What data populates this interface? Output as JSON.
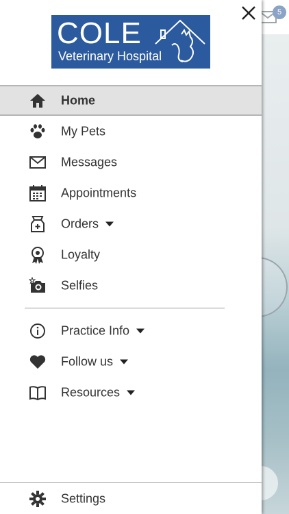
{
  "background": {
    "mail_badge_count": "5"
  },
  "logo": {
    "title": "COLE",
    "subtitle": "Veterinary Hospital"
  },
  "menu": {
    "items": [
      {
        "label": "Home",
        "icon": "home-icon",
        "active": true
      },
      {
        "label": "My Pets",
        "icon": "paw-icon"
      },
      {
        "label": "Messages",
        "icon": "envelope-icon"
      },
      {
        "label": "Appointments",
        "icon": "calendar-icon"
      },
      {
        "label": "Orders",
        "icon": "pet-food-bag-icon",
        "dropdown": true
      },
      {
        "label": "Loyalty",
        "icon": "award-ribbon-icon"
      },
      {
        "label": "Selfies",
        "icon": "camera-icon"
      }
    ],
    "secondary": [
      {
        "label": "Practice Info",
        "icon": "info-icon",
        "dropdown": true
      },
      {
        "label": "Follow us",
        "icon": "heart-icon",
        "dropdown": true
      },
      {
        "label": "Resources",
        "icon": "book-icon",
        "dropdown": true
      }
    ],
    "settings": {
      "label": "Settings",
      "icon": "gear-icon"
    }
  },
  "colors": {
    "brand": "#2c5a9e",
    "active_row": "#e2e2e2",
    "icon": "#333333"
  }
}
